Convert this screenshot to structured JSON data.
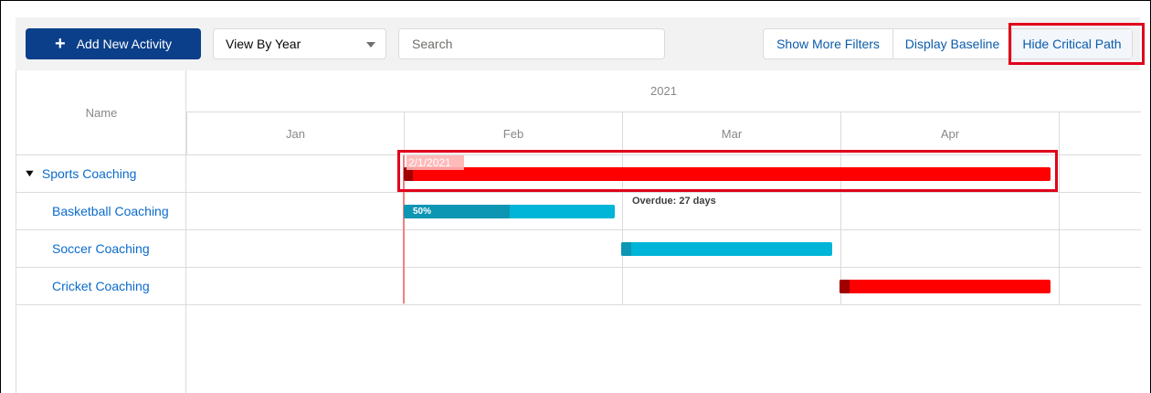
{
  "toolbar": {
    "add_label": "Add New Activity",
    "view_selected": "View By Year",
    "search_placeholder": "Search",
    "buttons": {
      "more_filters": "Show More Filters",
      "display_baseline": "Display Baseline",
      "hide_critical_path": "Hide Critical Path"
    }
  },
  "gantt": {
    "name_header": "Name",
    "year": "2021",
    "months": [
      "Jan",
      "Feb",
      "Mar",
      "Apr"
    ],
    "rows": [
      {
        "name": "Sports Coaching",
        "expanded": true,
        "date_label": "2/1/2021"
      },
      {
        "name": "Basketball Coaching",
        "progress_label": "50%",
        "progress": 0.5,
        "note": "Overdue: 27 days"
      },
      {
        "name": "Soccer Coaching"
      },
      {
        "name": "Cricket Coaching"
      }
    ]
  },
  "colors": {
    "primary": "#0b3f8a",
    "critical": "#ff0000",
    "task": "#00b5d8",
    "link": "#0b6bcb",
    "highlight": "#e0001b"
  },
  "icons": {
    "add": "plus-icon",
    "dropdown": "caret-down-icon",
    "expand": "chevron-down-icon"
  }
}
